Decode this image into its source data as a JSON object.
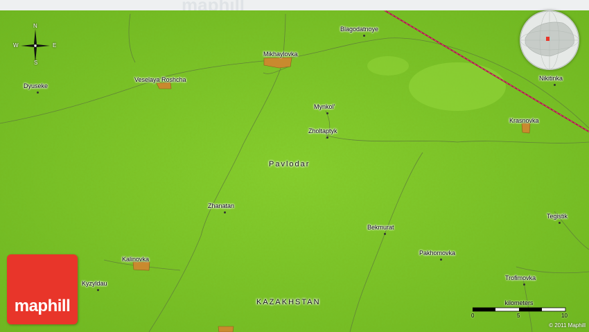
{
  "map": {
    "background_color": "#7ec82a",
    "region_label": "Pavlodar",
    "country_label": "KAZAKHSTAN",
    "places": [
      {
        "name": "Blagodatnoye"
      },
      {
        "name": "Mikhaylovka"
      },
      {
        "name": "Veselaya Roshcha"
      },
      {
        "name": "Dyuseke"
      },
      {
        "name": "Mynkol'"
      },
      {
        "name": "Zholtaptyk"
      },
      {
        "name": "Nikitinka"
      },
      {
        "name": "Krasnovka"
      },
      {
        "name": "Zhanatan"
      },
      {
        "name": "Bekmurat"
      },
      {
        "name": "Tegistik"
      },
      {
        "name": "Pakhomovka"
      },
      {
        "name": "Kalinovka"
      },
      {
        "name": "Kyzyldau"
      },
      {
        "name": "Trofimovka"
      }
    ]
  },
  "compass": {
    "north": "N",
    "south": "S",
    "east": "E",
    "west": "W"
  },
  "scale_bar": {
    "title": "kilometers",
    "ticks": [
      "0",
      "5",
      "10"
    ]
  },
  "logo": {
    "text": "maphill",
    "color": "#e8352a"
  },
  "watermark": "maphill",
  "copyright": "© 2011 Maphill"
}
